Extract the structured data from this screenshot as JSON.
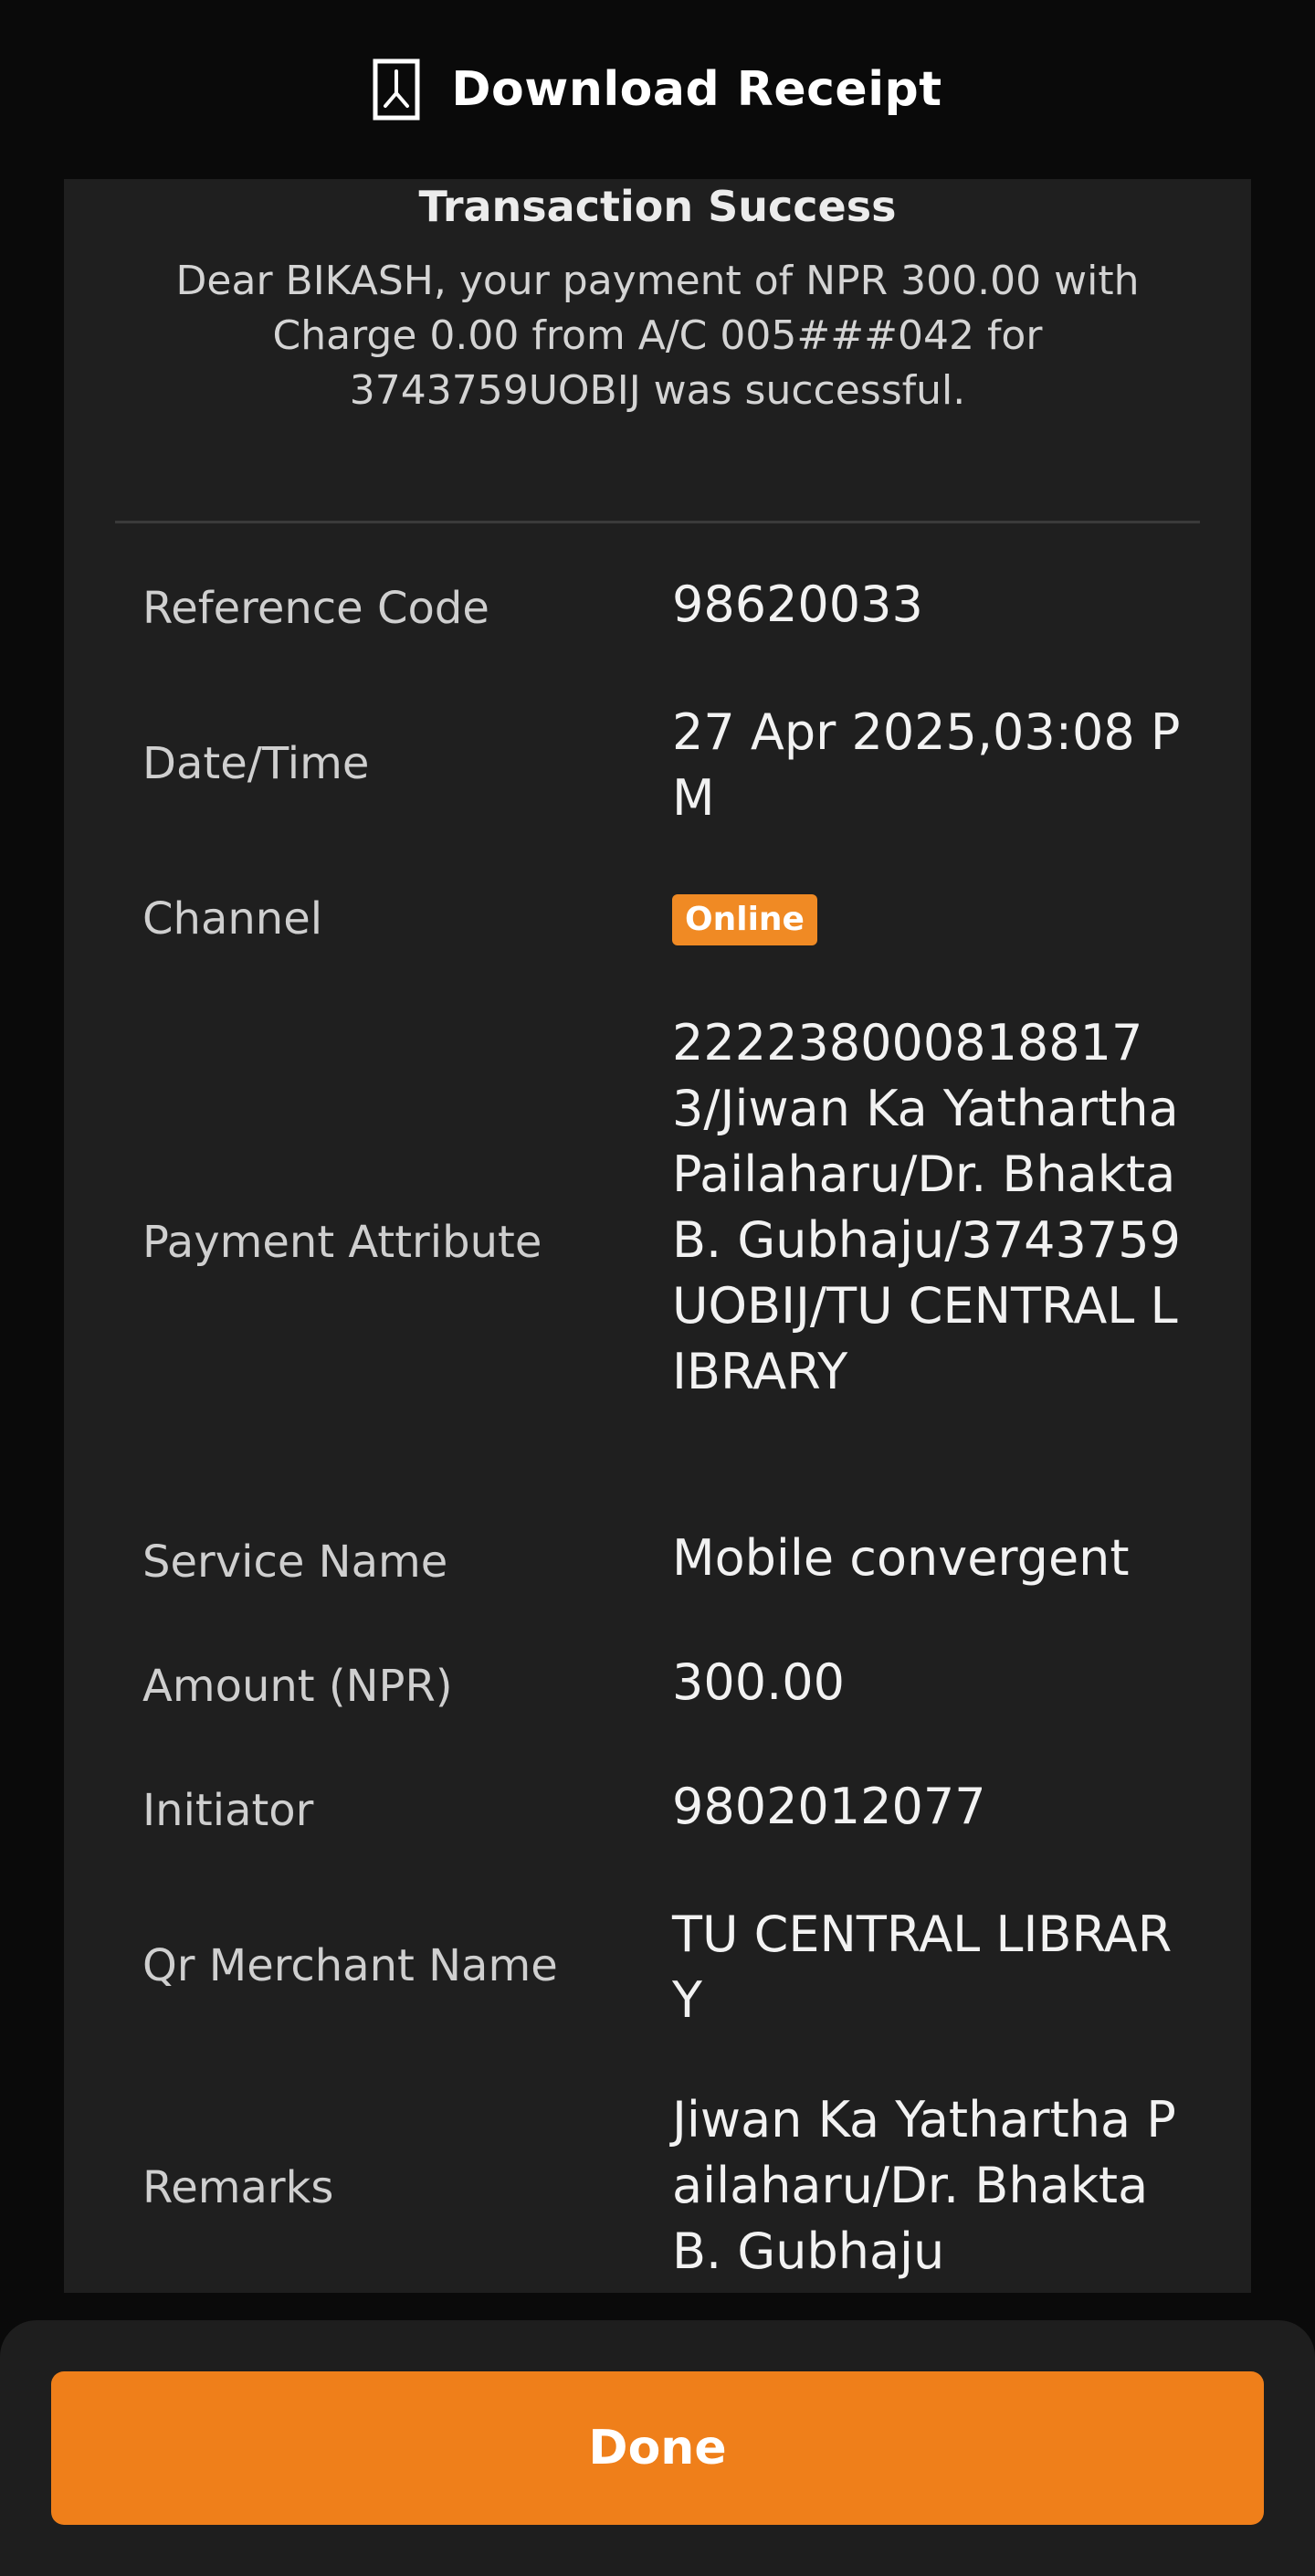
{
  "header": {
    "title": "Download Receipt",
    "icon": "pdf-document-icon"
  },
  "receipt": {
    "title": "Transaction Success",
    "message": "Dear BIKASH, your payment of NPR 300.00 with Charge 0.00 from A/C 005###042 for 3743759UOBIJ was successful.",
    "rows": [
      {
        "label": "Reference Code",
        "value": "98620033"
      },
      {
        "label": "Date/Time",
        "value": "27 Apr 2025,03:08 PM"
      },
      {
        "label": "Channel",
        "value": "Online"
      },
      {
        "label": "Payment Attribute",
        "value": "2222380008188173/Jiwan Ka Yathartha Pailaharu/Dr. Bhakta B. Gubhaju/3743759UOBIJ/TU CENTRAL LIBRARY"
      },
      {
        "label": "Service Name",
        "value": "Mobile convergent"
      },
      {
        "label": "Amount (NPR)",
        "value": "300.00"
      },
      {
        "label": "Initiator",
        "value": "9802012077"
      },
      {
        "label": "Qr Merchant Name",
        "value": "TU CENTRAL LIBRARY"
      },
      {
        "label": "Remarks",
        "value": "Jiwan Ka Yathartha Pailaharu/Dr. Bhakta B. Gubhaju"
      }
    ]
  },
  "footer": {
    "done_label": "Done"
  },
  "colors": {
    "accent": "#ef7f1a",
    "badge": "#f08a24",
    "card": "#1f1f1f",
    "background": "#0a0a0a"
  }
}
